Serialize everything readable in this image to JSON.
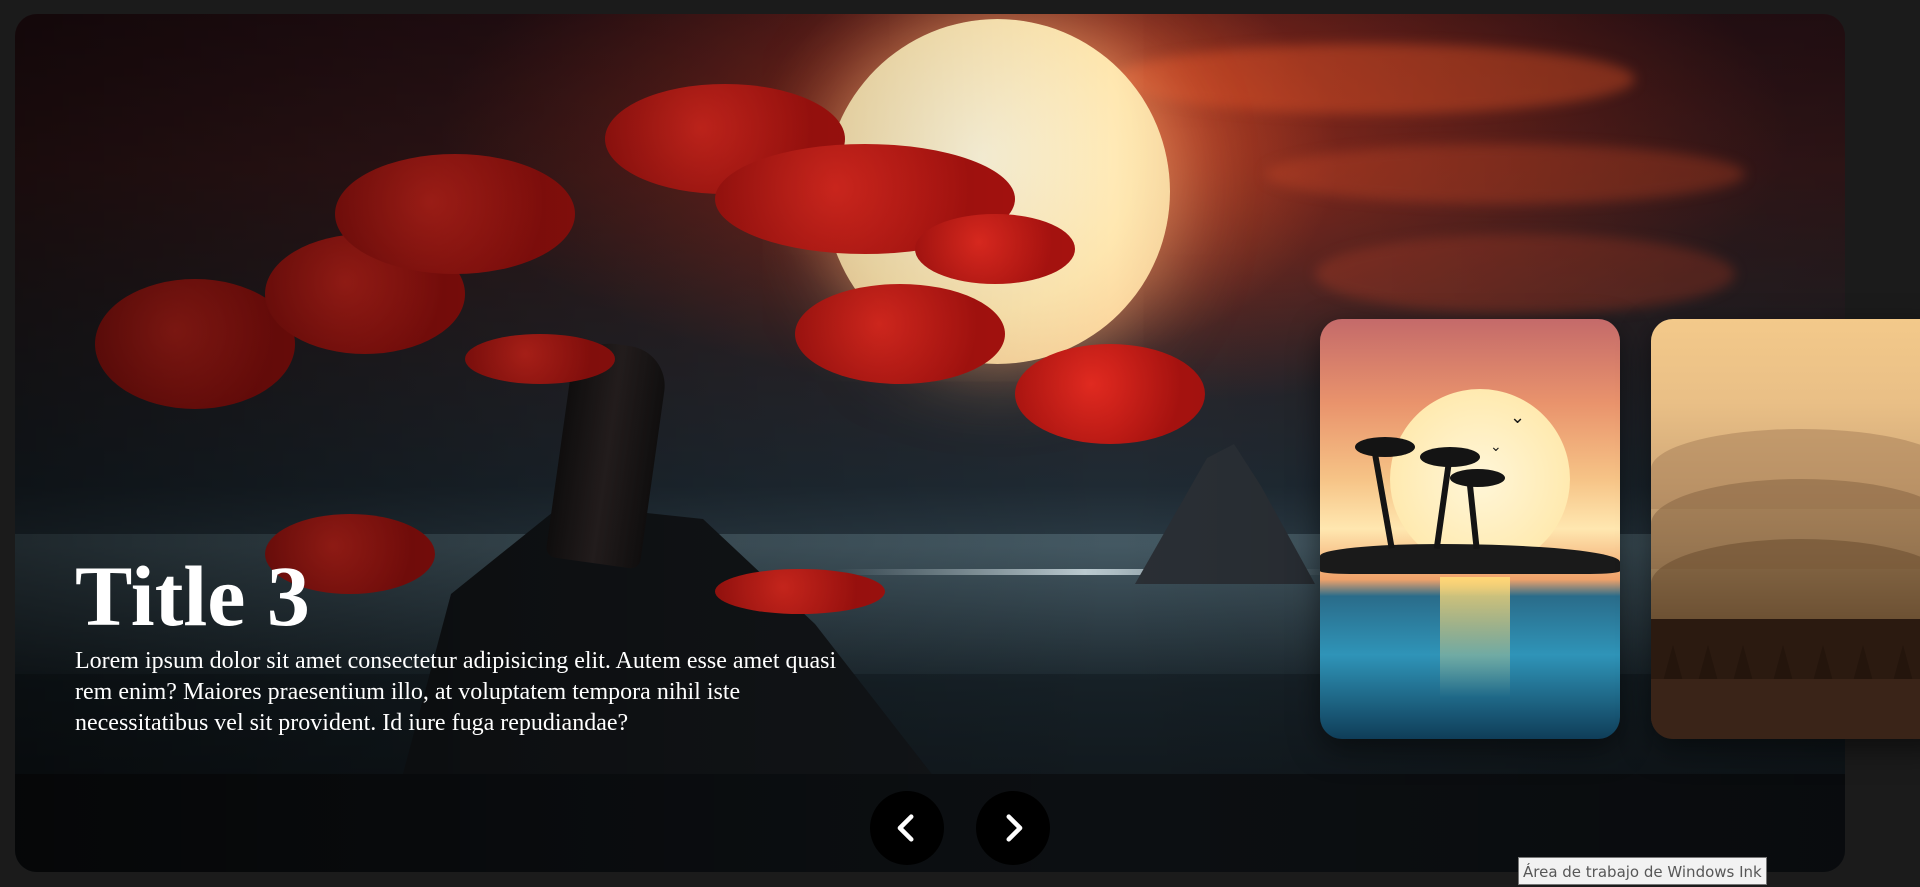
{
  "slide": {
    "title": "Title 3",
    "description": "Lorem ipsum dolor sit amet consectetur adipisicing elit. Autem esse amet quasi rem enim? Maiores praesentium illo, at voluptatem tempora nihil iste necessitatibus vel sit provident. Id iure fuga repudiandae?"
  },
  "navigation": {
    "prev_icon": "chevron-left-icon",
    "next_icon": "chevron-right-icon"
  },
  "tooltip": {
    "text": "Área de trabajo de Windows Ink"
  },
  "colors": {
    "background": "#1b1b1b",
    "button": "#000000",
    "text": "#ffffff"
  }
}
